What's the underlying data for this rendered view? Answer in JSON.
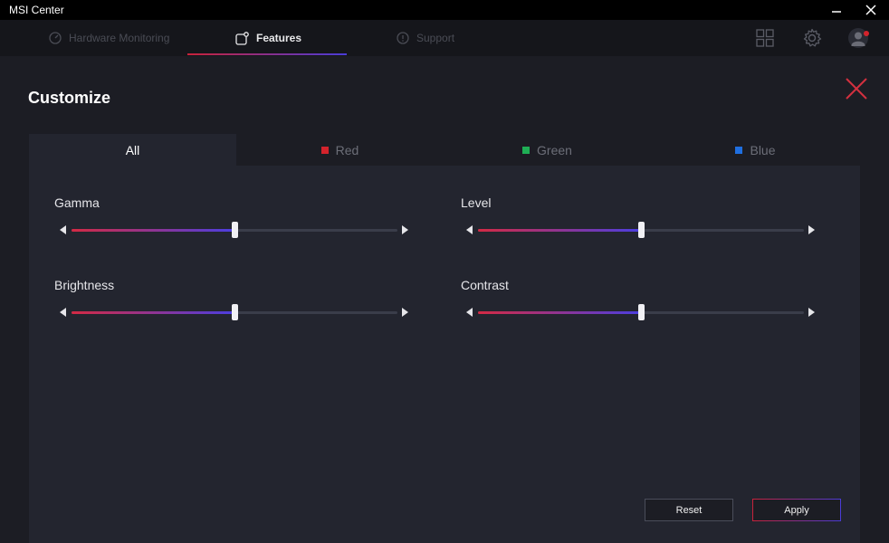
{
  "window": {
    "title": "MSI Center"
  },
  "nav": {
    "tabs": [
      {
        "label": "Hardware Monitoring"
      },
      {
        "label": "Features"
      },
      {
        "label": "Support"
      }
    ],
    "active": "Features"
  },
  "page": {
    "title": "Customize"
  },
  "channels": {
    "tabs": [
      {
        "label": "All",
        "color": ""
      },
      {
        "label": "Red",
        "color": "#d3232c"
      },
      {
        "label": "Green",
        "color": "#1fae55"
      },
      {
        "label": "Blue",
        "color": "#1f6fe0"
      }
    ],
    "active": "All"
  },
  "sliders": [
    {
      "label": "Gamma",
      "value_percent": 50
    },
    {
      "label": "Level",
      "value_percent": 50
    },
    {
      "label": "Brightness",
      "value_percent": 50
    },
    {
      "label": "Contrast",
      "value_percent": 50
    }
  ],
  "buttons": {
    "reset": "Reset",
    "apply": "Apply"
  },
  "colors": {
    "accent_red": "#c8223a",
    "accent_blue": "#4a3cd8"
  },
  "icons": [
    "minimize-icon",
    "close-icon",
    "speedometer-icon",
    "features-icon",
    "info-icon",
    "grid-icon",
    "gear-icon",
    "avatar-icon",
    "close-x-icon"
  ]
}
